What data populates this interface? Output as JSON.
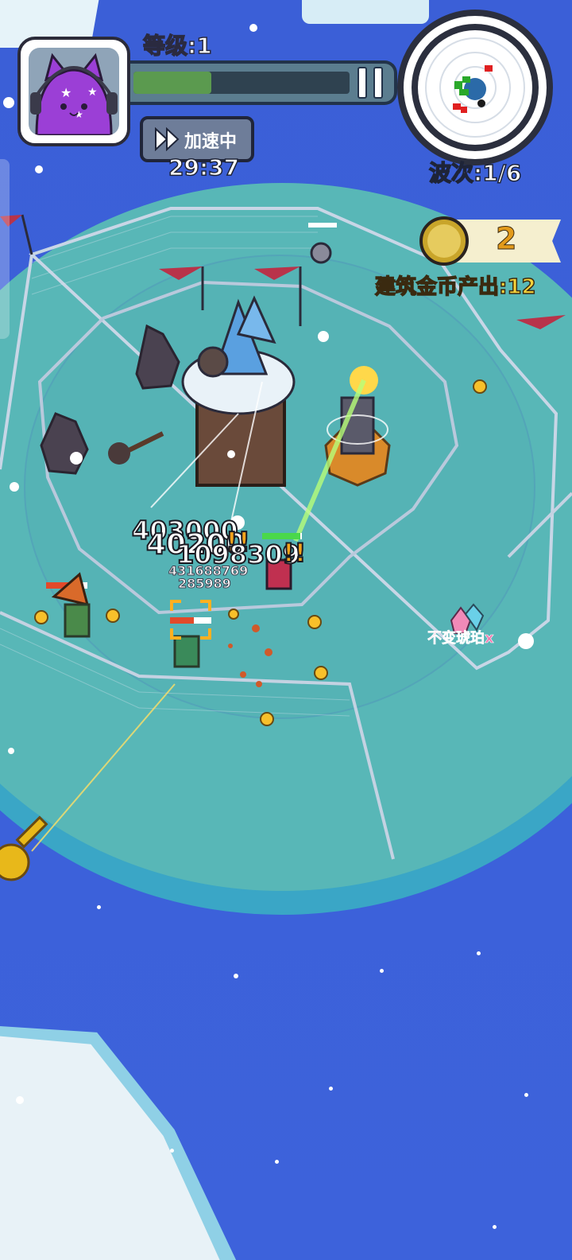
{
  "hud": {
    "level_label": "等级:1",
    "level_progress": 0.36,
    "speed_button_label": "加速中",
    "timer": "29:37",
    "wave_label": "波次:1/6",
    "coin_count": "2",
    "building_income_label": "建筑金币产出:12"
  },
  "battlefield": {
    "damage_numbers": [
      "403000",
      "40200",
      "!!",
      "1098309",
      "!!",
      "431688769",
      "285989"
    ],
    "pickup_label": "不变琥珀x"
  },
  "colors": {
    "ocean": "#3d62db",
    "island": "#58b7b7",
    "progress_fill": "#5b9a4f",
    "income_text": "#f6d23a",
    "coin_text": "#e39b1c",
    "pickup_text": "#f07ab0"
  }
}
